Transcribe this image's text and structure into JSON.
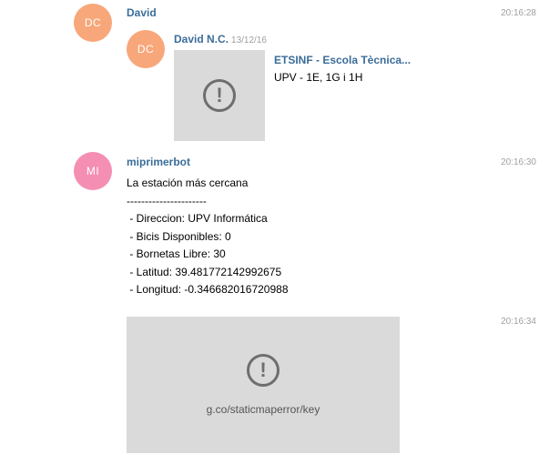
{
  "messages": [
    {
      "avatar_initials": "DC",
      "avatar_color": "#f7a77a",
      "author": "David",
      "time": "20:16:28",
      "forwarded": {
        "avatar_initials": "DC",
        "avatar_color": "#f7a77a",
        "author": "David N.C.",
        "date": "13/12/16",
        "link_title": "ETSINF - Escola Tècnica...",
        "link_description": "UPV - 1E, 1G i 1H"
      }
    },
    {
      "avatar_initials": "MI",
      "avatar_color": "#f58eb3",
      "author": "miprimerbot",
      "time": "20:16:30",
      "lines": [
        "La estación más cercana",
        "----------------------",
        " - Direccion: UPV Informática",
        " - Bicis Disponibles: 0",
        " - Bornetas Libre: 30",
        " - Latitud: 39.481772142992675",
        " - Longitud: -0.346682016720988"
      ]
    },
    {
      "time": "20:16:34",
      "map_error_text": "g.co/staticmaperror/key"
    }
  ],
  "colors": {
    "author_link": "#3a6d99",
    "timestamp": "#a0a0a0",
    "placeholder_bg": "#dadada"
  }
}
